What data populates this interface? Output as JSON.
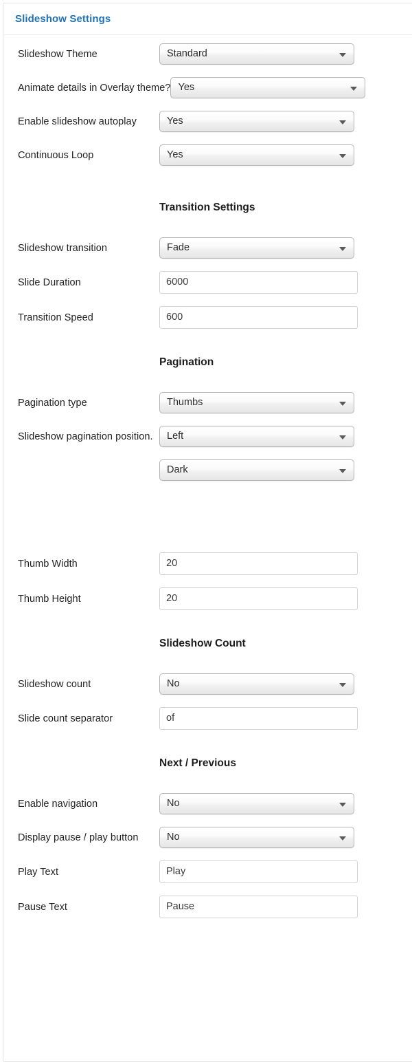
{
  "panel": {
    "title": "Slideshow Settings"
  },
  "rows": [
    {
      "label": "Slideshow Theme",
      "control": "select",
      "value": "Standard"
    },
    {
      "label": "Animate details in Overlay theme?",
      "control": "select",
      "value": "Yes"
    },
    {
      "label": "Enable slideshow autoplay",
      "control": "select",
      "value": "Yes"
    },
    {
      "label": "Continuous Loop",
      "control": "select",
      "value": "Yes"
    }
  ],
  "sections": [
    {
      "heading": "Transition Settings",
      "rows": [
        {
          "label": "Slideshow transition",
          "control": "select",
          "value": "Fade"
        },
        {
          "label": "Slide Duration",
          "control": "textbox",
          "value": "6000"
        },
        {
          "label": "Transition Speed",
          "control": "textbox",
          "value": "600"
        }
      ]
    },
    {
      "heading": "Pagination",
      "rows": [
        {
          "label": "Pagination type",
          "control": "select",
          "value": "Thumbs"
        },
        {
          "label": "Slideshow pagination position.",
          "control": "select",
          "value": "Left"
        },
        {
          "label": "",
          "control": "select",
          "value": "Dark"
        },
        {
          "label": "Thumb Width",
          "control": "textbox",
          "value": "20"
        },
        {
          "label": "Thumb Height",
          "control": "textbox",
          "value": "20"
        }
      ]
    },
    {
      "heading": "Slideshow Count",
      "rows": [
        {
          "label": "Slideshow count",
          "control": "select",
          "value": "No"
        },
        {
          "label": "Slide count separator",
          "control": "textbox",
          "value": "of"
        }
      ]
    },
    {
      "heading": "Next / Previous",
      "rows": [
        {
          "label": "Enable navigation",
          "control": "select",
          "value": "No"
        },
        {
          "label": "Display pause / play button",
          "control": "select",
          "value": "No"
        },
        {
          "label": "Play Text",
          "control": "textbox",
          "value": "Play"
        },
        {
          "label": "Pause Text",
          "control": "textbox",
          "value": "Pause"
        }
      ]
    }
  ],
  "icons": {
    "dropdown": "chevron-down-icon"
  },
  "colors": {
    "heading_blue": "#2272b5",
    "text": "#222222",
    "panel_border": "#e3e3e3"
  }
}
